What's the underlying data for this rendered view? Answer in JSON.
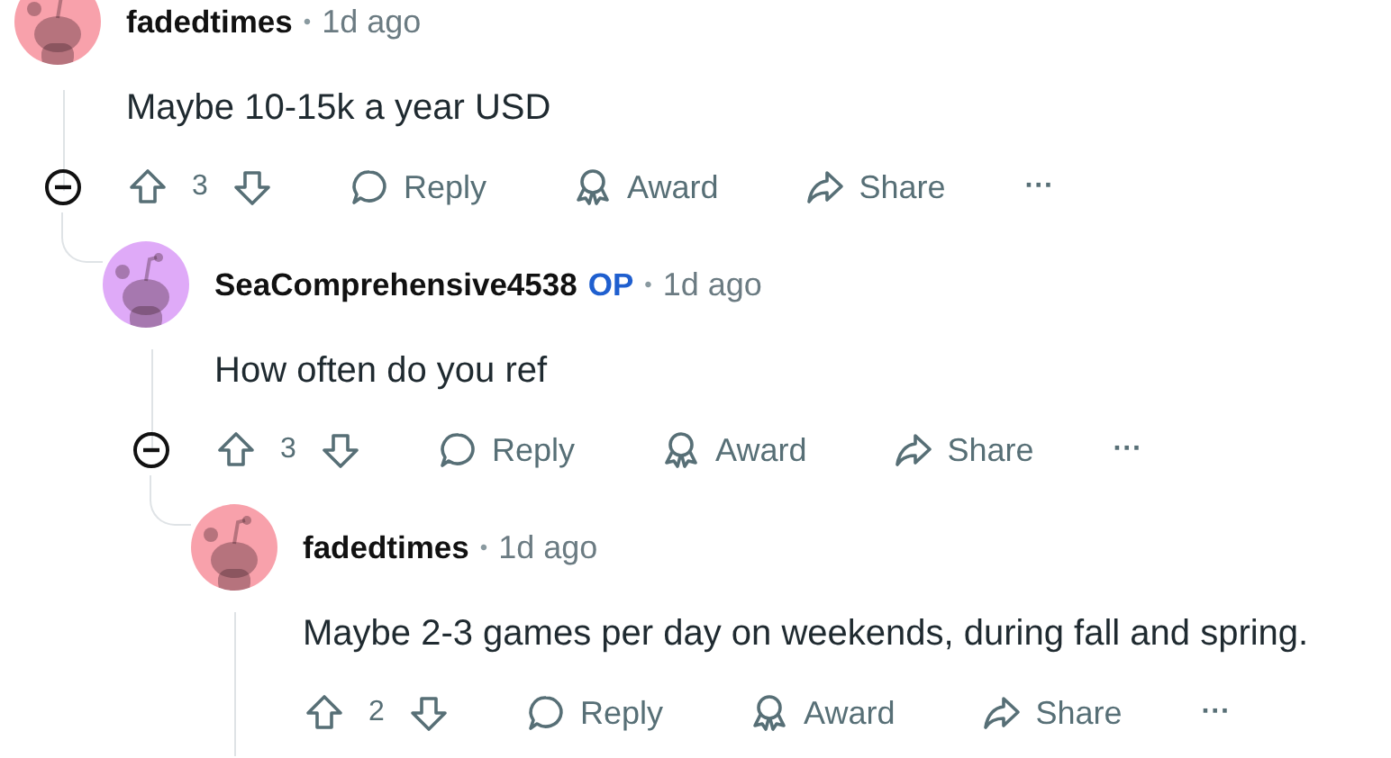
{
  "comments": [
    {
      "author": "fadedtimes",
      "separator": "•",
      "time": "1d ago",
      "color": "#f8a1ab",
      "body": "Maybe 10-15k a year USD",
      "score": "3",
      "actions": [
        "Reply",
        "Award",
        "Share"
      ],
      "more": "···",
      "expanded": true,
      "children": [
        {
          "author": "SeaComprehensive4538",
          "flair": "OP",
          "separator": "•",
          "time": "1d ago",
          "color": "#dfaaf8",
          "body": "How often do you ref",
          "score": "3",
          "actions": [
            "Reply",
            "Award",
            "Share"
          ],
          "more": "···",
          "expanded": true,
          "children": [
            {
              "author": "fadedtimes",
              "separator": "•",
              "time": "1d ago",
              "color": "#f8a1ab",
              "body": "Maybe 2-3 games per day on weekends, during fall and spring.",
              "score": "2",
              "actions": [
                "Reply",
                "Award",
                "Share"
              ],
              "more": "···"
            }
          ]
        }
      ]
    }
  ]
}
